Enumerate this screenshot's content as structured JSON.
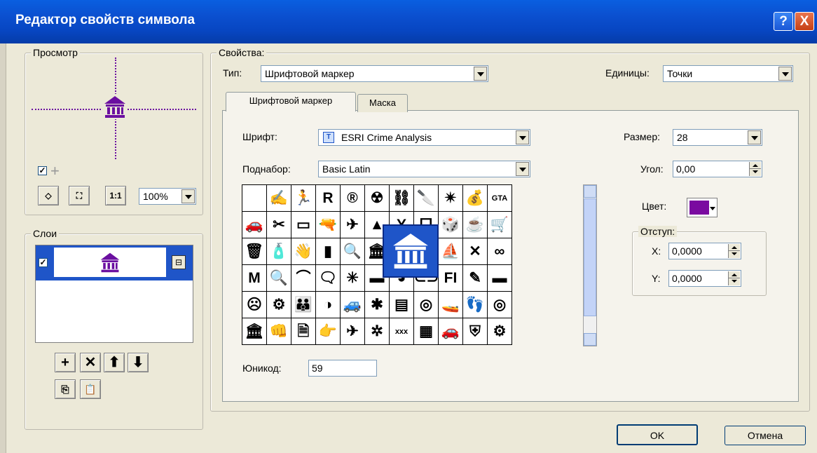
{
  "window": {
    "title": "Редактор свойств символа",
    "help": "?",
    "close": "X"
  },
  "preview": {
    "legend": "Просмотр",
    "zoom": "100%",
    "tool1": "◇",
    "tool2": "⛶",
    "tool3": "1:1"
  },
  "layers": {
    "legend": "Слои"
  },
  "properties": {
    "legend": "Свойства:",
    "type_label": "Тип:",
    "type_value": "Шрифтовой маркер",
    "units_label": "Единицы:",
    "units_value": "Точки"
  },
  "tabs": [
    {
      "label": "Шрифтовой маркер"
    },
    {
      "label": "Маска"
    }
  ],
  "font_marker": {
    "font_label": "Шрифт:",
    "font_value": "ESRI Crime Analysis",
    "subset_label": "Поднабор:",
    "subset_value": "Basic Latin",
    "unicode_label": "Юникод:",
    "unicode_value": "59",
    "size_label": "Размер:",
    "size_value": "28",
    "angle_label": "Угол:",
    "angle_value": "0,00",
    "color_label": "Цвет:",
    "color": "#7a0aa0",
    "offset_legend": "Отступ:",
    "x_label": "X:",
    "x_value": "0,0000",
    "y_label": "Y:",
    "y_value": "0,0000"
  },
  "glyph_grid": {
    "rows": [
      [
        "",
        "✍",
        "🏃",
        "R",
        "®",
        "☢",
        "⛓",
        "🔪",
        "✴",
        "💰",
        "GTA"
      ],
      [
        "🚗",
        "✂",
        "▭",
        "🔫",
        "✈",
        "▲",
        "Y",
        "ᗜ",
        "🎲",
        "☕",
        "🛒"
      ],
      [
        "🗑",
        "🧴",
        "👋",
        "▮",
        "🔍",
        "🏛",
        "≡",
        "🚘",
        "⛵",
        "✕",
        "∞"
      ],
      [
        "M",
        "🔍",
        "⌒",
        "🗨",
        "✳",
        "▬",
        "◕",
        "⊂⊃",
        "FI",
        "✎",
        "▬"
      ],
      [
        "☹",
        "⚙",
        "👪",
        "◑",
        "🚙",
        "✱",
        "▤",
        "◎",
        "🚤",
        "👣",
        "◎"
      ],
      [
        "🏛",
        "👊",
        "🗎",
        "👉",
        "✈",
        "✲",
        "xxx",
        "▦",
        "🚗",
        "⛨",
        "⚙"
      ]
    ]
  },
  "buttons": {
    "ok": "OK",
    "cancel": "Отмена"
  },
  "icons": {
    "symbol_color": "#6b0fa0",
    "selection_color": "#1f55c8"
  }
}
